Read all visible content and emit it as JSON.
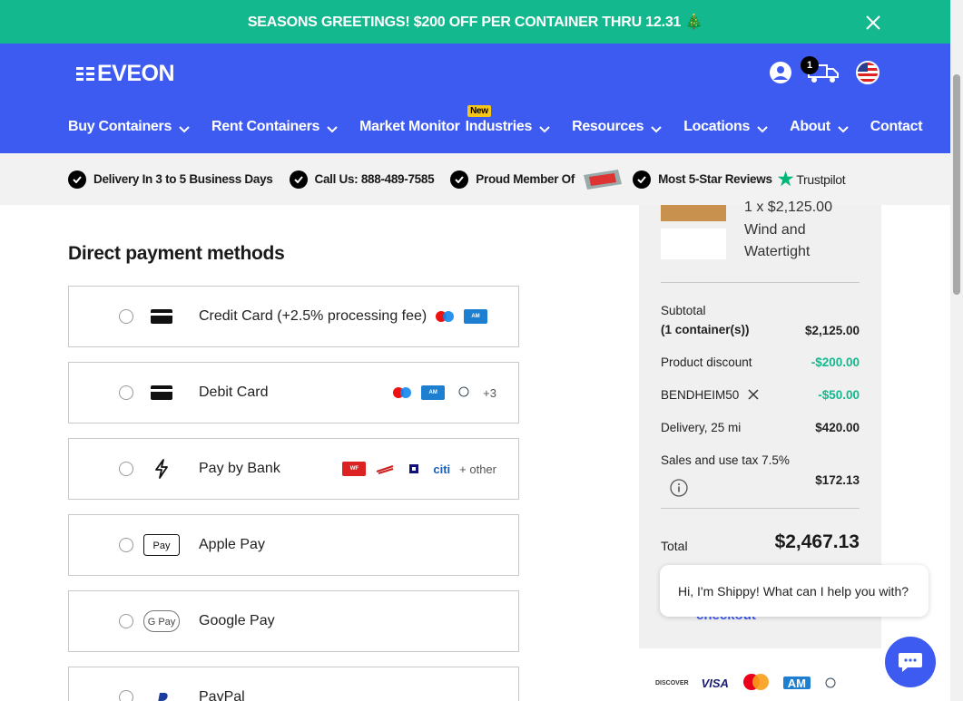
{
  "promo": {
    "text": "SEASONS GREETINGS! $200 OFF PER CONTAINER THRU 12.31 🎄"
  },
  "header": {
    "logo": "EVEON",
    "cart_count": "1",
    "nav": [
      {
        "label": "Buy Containers",
        "has_chevron": true
      },
      {
        "label": "Rent Containers",
        "has_chevron": true
      },
      {
        "label": "Market Monitor",
        "has_chevron": false,
        "badge": "New"
      },
      {
        "label": "Industries",
        "has_chevron": true
      },
      {
        "label": "Resources",
        "has_chevron": true
      },
      {
        "label": "Locations",
        "has_chevron": true
      },
      {
        "label": "About",
        "has_chevron": true
      },
      {
        "label": "Contact",
        "has_chevron": false
      }
    ]
  },
  "trust": {
    "delivery": "Delivery In 3 to 5 Business Days",
    "call": "Call Us: 888-489-7585",
    "member": "Proud Member Of",
    "reviews": "Most 5-Star Reviews",
    "trustpilot": "Trustpilot"
  },
  "payment": {
    "title": "Direct payment methods",
    "methods": [
      {
        "label": "Credit Card (+2.5% processing fee)",
        "icon": "credit-card-icon",
        "extra": ""
      },
      {
        "label": "Debit Card",
        "icon": "credit-card-icon",
        "extra": "+3"
      },
      {
        "label": "Pay by Bank",
        "icon": "lightning-icon",
        "extra": "+ other"
      },
      {
        "label": "Apple Pay",
        "icon": "apple-pay-icon",
        "extra": ""
      },
      {
        "label": "Google Pay",
        "icon": "google-pay-icon",
        "extra": ""
      },
      {
        "label": "PayPal",
        "icon": "paypal-icon",
        "extra": ""
      }
    ]
  },
  "summary": {
    "product_qty": "1 x $2,125.00",
    "product_name": "Wind and Watertight",
    "subtotal_label": "Subtotal",
    "subtotal_sub": "(1 container(s))",
    "subtotal": "$2,125.00",
    "discount_label": "Product discount",
    "discount": "-$200.00",
    "coupon_label": "BENDHEIM50",
    "coupon": "-$50.00",
    "delivery_label": "Delivery, 25 mi",
    "delivery": "$420.00",
    "tax_label": "Sales and use tax 7.5%",
    "tax": "$172.13",
    "total_label": "Total",
    "total": "$2,467.13",
    "checkout_link": "checkout"
  },
  "chat": {
    "message": "Hi, I'm Shippy! What can I help you with?"
  },
  "cards": {
    "discover": "DISCOVER",
    "visa": "VISA"
  },
  "colors": {
    "brand": "#3d5af1",
    "promo": "#14b88e",
    "green_text": "#14b88e"
  }
}
